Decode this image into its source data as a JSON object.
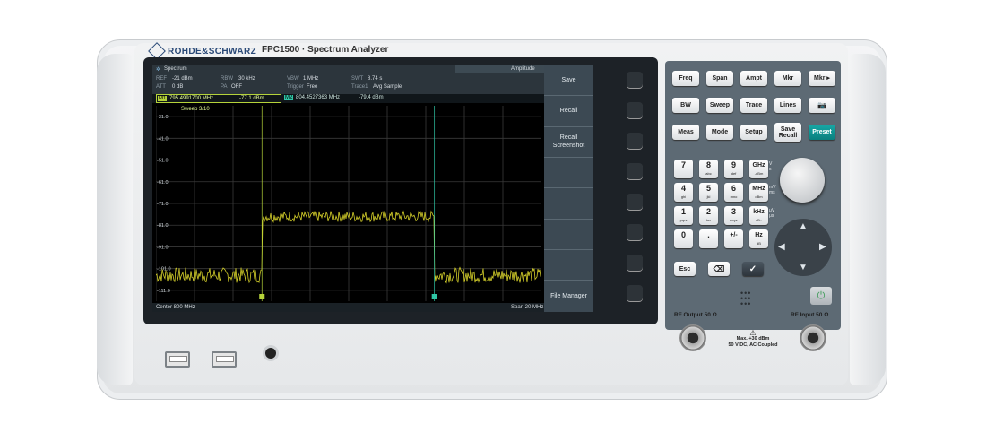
{
  "brand": "ROHDE&SCHWARZ",
  "model": "FPC1500 · Spectrum Analyzer",
  "screen": {
    "app_title": "Spectrum",
    "mode": "Amplitude",
    "params": [
      {
        "label": "REF",
        "value": "-21 dBm"
      },
      {
        "label": "ATT",
        "value": "0 dB"
      },
      {
        "label": "RBW",
        "value": "30 kHz"
      },
      {
        "label": "PA",
        "value": "OFF"
      },
      {
        "label": "VBW",
        "value": "1 MHz"
      },
      {
        "label": "Trigger",
        "value": "Free"
      },
      {
        "label": "SWT",
        "value": "8.74 s"
      },
      {
        "label": "Trace1",
        "value": "Avg Sample"
      }
    ],
    "markers": [
      {
        "id": "M1",
        "freq": "795.4991700 MHz",
        "level": "-77.1 dBm"
      },
      {
        "id": "M2",
        "freq": "804.4527363 MHz",
        "level": "-79.4 dBm"
      }
    ],
    "sweep": "Sweep 3/10",
    "center": "Center 800 MHz",
    "span": "Span 20 MHz",
    "y_ticks": [
      "-31.0",
      "-41.0",
      "-51.0",
      "-61.0",
      "-71.0",
      "-81.0",
      "-91.0",
      "-101.0",
      "-111.0"
    ],
    "softkeys": [
      "Save",
      "Recall",
      "Recall\nScreenshot",
      "",
      "",
      "",
      "",
      "File Manager"
    ]
  },
  "chart_data": {
    "type": "line",
    "series": [
      {
        "values_description_free": true
      }
    ],
    "x_center_mhz": 800,
    "x_span_mhz": 20,
    "ylim": [
      -116,
      -26
    ],
    "grid": true,
    "plateau_start_mhz": 795.5,
    "plateau_end_mhz": 804.45,
    "plateau_level_dbm": -77,
    "noise_floor_dbm": -104,
    "trace_color": "#d4cf2a"
  },
  "keys": {
    "row1": [
      "Freq",
      "Span",
      "Ampt",
      "Mkr",
      "Mkr ▸"
    ],
    "row2": [
      "BW",
      "Sweep",
      "Trace",
      "Lines",
      "📷"
    ],
    "row3": [
      "Meas",
      "Mode",
      "Setup",
      "Save\nRecall",
      "Preset"
    ],
    "digits": [
      {
        "d": "7",
        "s": ""
      },
      {
        "d": "8",
        "s": "abc"
      },
      {
        "d": "9",
        "s": "def"
      },
      {
        "d": "GHz",
        "s": "-dBm"
      },
      {
        "d": "4",
        "s": "ghi"
      },
      {
        "d": "5",
        "s": "jkl"
      },
      {
        "d": "6",
        "s": "mno"
      },
      {
        "d": "MHz",
        "s": "dBm"
      },
      {
        "d": "1",
        "s": "pqrs"
      },
      {
        "d": "2",
        "s": "tuv"
      },
      {
        "d": "3",
        "s": "wxyz"
      },
      {
        "d": "kHz",
        "s": "dB.."
      },
      {
        "d": "0",
        "s": ""
      },
      {
        "d": ".",
        "s": ""
      },
      {
        "d": "+/-",
        "s": ""
      },
      {
        "d": "Hz",
        "s": "dB"
      }
    ],
    "units_side": [
      [
        "V",
        "s"
      ],
      [
        "mV",
        "ms"
      ],
      [
        "μV",
        "μs"
      ]
    ],
    "bottom": [
      "Esc",
      "⌫",
      "✓"
    ]
  },
  "rf": {
    "output": "RF Output 50 Ω",
    "input": "RF Input 50 Ω",
    "warning": [
      "Max. +30 dBm",
      "50 V DC, AC Coupled"
    ]
  }
}
